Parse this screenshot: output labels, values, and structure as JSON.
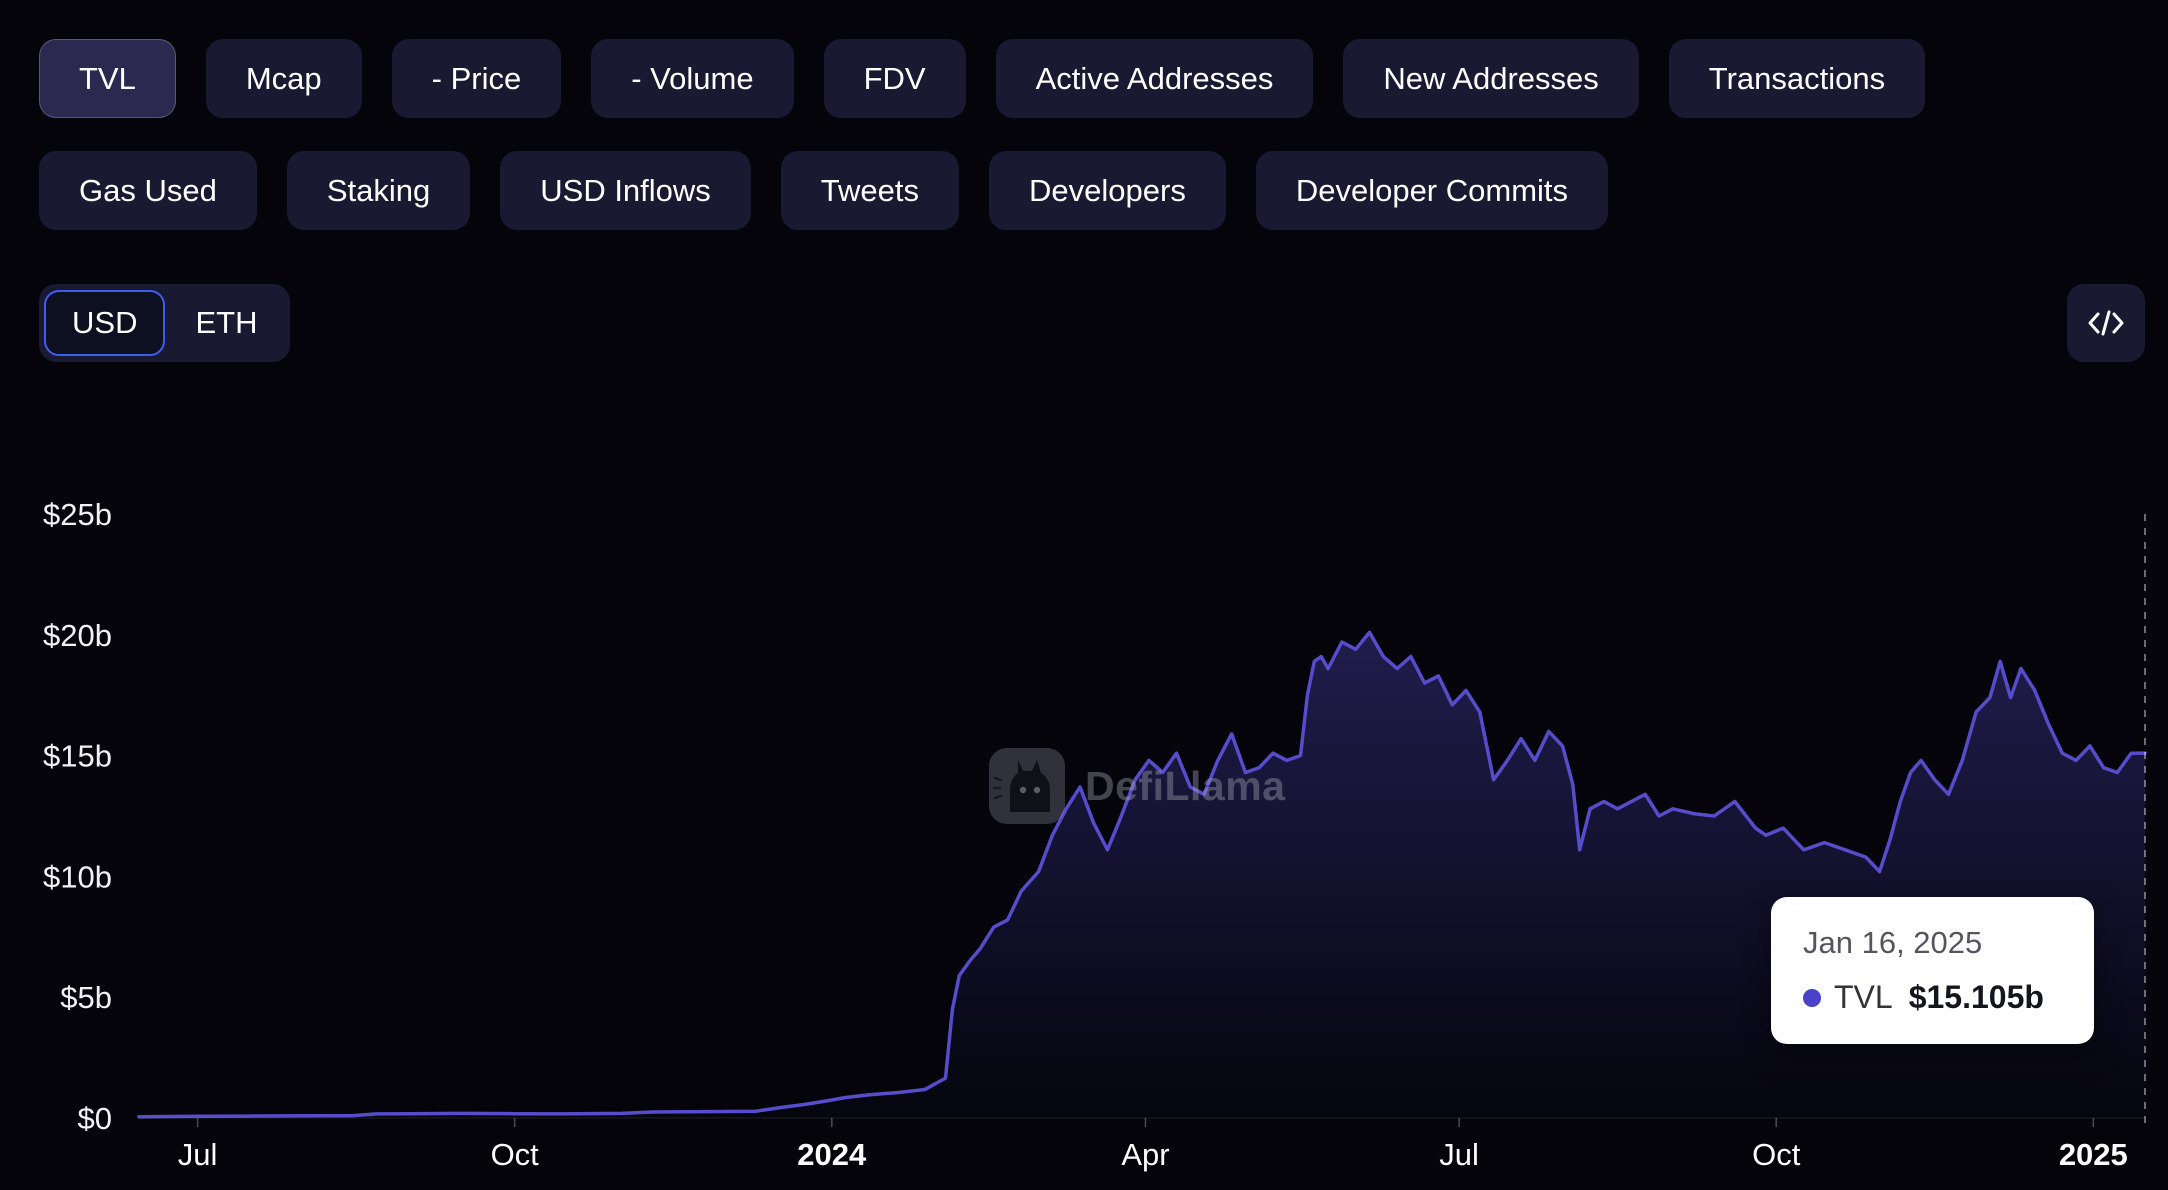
{
  "metric_tabs": {
    "row1": [
      {
        "label": "TVL",
        "active": true
      },
      {
        "label": "Mcap",
        "active": false
      },
      {
        "label": "- Price",
        "active": false
      },
      {
        "label": "- Volume",
        "active": false
      },
      {
        "label": "FDV",
        "active": false
      },
      {
        "label": "Active Addresses",
        "active": false
      },
      {
        "label": "New Addresses",
        "active": false
      },
      {
        "label": "Transactions",
        "active": false
      }
    ],
    "row2": [
      {
        "label": "Gas Used",
        "active": false
      },
      {
        "label": "Staking",
        "active": false
      },
      {
        "label": "USD Inflows",
        "active": false
      },
      {
        "label": "Tweets",
        "active": false
      },
      {
        "label": "Developers",
        "active": false
      },
      {
        "label": "Developer Commits",
        "active": false
      }
    ]
  },
  "currency_toggle": {
    "options": [
      "USD",
      "ETH"
    ],
    "selected": "USD"
  },
  "embed_button": {
    "icon": "code-embed-icon"
  },
  "watermark": {
    "icon": "defillama-logo-icon",
    "text": "DefiLlama"
  },
  "tooltip": {
    "date": "Jan 16, 2025",
    "series": "TVL",
    "value": "$15.105b",
    "marker_color": "#4c41c9"
  },
  "colors": {
    "background": "#04040a",
    "button_bg": "#1a1932",
    "button_active_bg": "#2b2950",
    "toggle_selected_border": "#3e5df0",
    "line": "#564ccc",
    "tooltip_bg": "#ffffff",
    "crosshair": "rgba(255,255,255,0.55)"
  },
  "chart_data": {
    "type": "area",
    "title": "",
    "xlabel": "",
    "ylabel": "",
    "unit": "USD billions",
    "grid": false,
    "legend": false,
    "ylim": [
      0,
      25
    ],
    "x_range": [
      "2023-06-14",
      "2025-01-16"
    ],
    "y_ticks": [
      {
        "label": "$0",
        "value": 0
      },
      {
        "label": "$5b",
        "value": 5
      },
      {
        "label": "$10b",
        "value": 10
      },
      {
        "label": "$15b",
        "value": 15
      },
      {
        "label": "$20b",
        "value": 20
      },
      {
        "label": "$25b",
        "value": 25
      }
    ],
    "x_ticks": [
      {
        "label": "Jul",
        "date": "2023-07-01",
        "bold": false
      },
      {
        "label": "Oct",
        "date": "2023-10-01",
        "bold": false
      },
      {
        "label": "2024",
        "date": "2024-01-01",
        "bold": true
      },
      {
        "label": "Apr",
        "date": "2024-04-01",
        "bold": false
      },
      {
        "label": "Jul",
        "date": "2024-07-01",
        "bold": false
      },
      {
        "label": "Oct",
        "date": "2024-10-01",
        "bold": false
      },
      {
        "label": "2025",
        "date": "2025-01-01",
        "bold": true
      }
    ],
    "crosshair_date": "2025-01-16",
    "highlight": {
      "date": "2025-01-16",
      "value": 15.105
    },
    "series": [
      {
        "name": "TVL",
        "color": "#564ccc",
        "points": [
          [
            "2023-06-14",
            0.05
          ],
          [
            "2023-07-01",
            0.07
          ],
          [
            "2023-07-15",
            0.08
          ],
          [
            "2023-08-01",
            0.09
          ],
          [
            "2023-08-15",
            0.1
          ],
          [
            "2023-08-22",
            0.17
          ],
          [
            "2023-09-01",
            0.18
          ],
          [
            "2023-09-15",
            0.19
          ],
          [
            "2023-10-01",
            0.18
          ],
          [
            "2023-10-15",
            0.17
          ],
          [
            "2023-11-01",
            0.19
          ],
          [
            "2023-11-10",
            0.25
          ],
          [
            "2023-11-20",
            0.26
          ],
          [
            "2023-12-01",
            0.27
          ],
          [
            "2023-12-10",
            0.28
          ],
          [
            "2023-12-18",
            0.45
          ],
          [
            "2023-12-24",
            0.56
          ],
          [
            "2023-12-31",
            0.72
          ],
          [
            "2024-01-05",
            0.85
          ],
          [
            "2024-01-12",
            0.96
          ],
          [
            "2024-01-20",
            1.05
          ],
          [
            "2024-01-28",
            1.18
          ],
          [
            "2024-02-03",
            1.65
          ],
          [
            "2024-02-05",
            4.5
          ],
          [
            "2024-02-07",
            5.9
          ],
          [
            "2024-02-10",
            6.5
          ],
          [
            "2024-02-13",
            7.0
          ],
          [
            "2024-02-17",
            7.9
          ],
          [
            "2024-02-21",
            8.2
          ],
          [
            "2024-02-25",
            9.4
          ],
          [
            "2024-03-01",
            10.2
          ],
          [
            "2024-03-05",
            11.7
          ],
          [
            "2024-03-09",
            12.8
          ],
          [
            "2024-03-13",
            13.7
          ],
          [
            "2024-03-17",
            12.2
          ],
          [
            "2024-03-21",
            11.1
          ],
          [
            "2024-03-25",
            12.5
          ],
          [
            "2024-03-29",
            14.0
          ],
          [
            "2024-04-02",
            14.8
          ],
          [
            "2024-04-06",
            14.3
          ],
          [
            "2024-04-10",
            15.1
          ],
          [
            "2024-04-14",
            13.7
          ],
          [
            "2024-04-18",
            13.4
          ],
          [
            "2024-04-22",
            14.8
          ],
          [
            "2024-04-26",
            15.9
          ],
          [
            "2024-04-30",
            14.3
          ],
          [
            "2024-05-04",
            14.5
          ],
          [
            "2024-05-08",
            15.1
          ],
          [
            "2024-05-12",
            14.8
          ],
          [
            "2024-05-16",
            15.0
          ],
          [
            "2024-05-18",
            17.5
          ],
          [
            "2024-05-20",
            18.9
          ],
          [
            "2024-05-22",
            19.1
          ],
          [
            "2024-05-24",
            18.6
          ],
          [
            "2024-05-28",
            19.7
          ],
          [
            "2024-06-01",
            19.4
          ],
          [
            "2024-06-05",
            20.1
          ],
          [
            "2024-06-09",
            19.1
          ],
          [
            "2024-06-13",
            18.6
          ],
          [
            "2024-06-17",
            19.1
          ],
          [
            "2024-06-21",
            18.0
          ],
          [
            "2024-06-25",
            18.3
          ],
          [
            "2024-06-29",
            17.1
          ],
          [
            "2024-07-03",
            17.7
          ],
          [
            "2024-07-07",
            16.8
          ],
          [
            "2024-07-11",
            14.0
          ],
          [
            "2024-07-15",
            14.8
          ],
          [
            "2024-07-19",
            15.7
          ],
          [
            "2024-07-23",
            14.8
          ],
          [
            "2024-07-27",
            16.0
          ],
          [
            "2024-07-31",
            15.4
          ],
          [
            "2024-08-03",
            13.8
          ],
          [
            "2024-08-05",
            11.1
          ],
          [
            "2024-08-08",
            12.8
          ],
          [
            "2024-08-12",
            13.1
          ],
          [
            "2024-08-16",
            12.8
          ],
          [
            "2024-08-20",
            13.1
          ],
          [
            "2024-08-24",
            13.4
          ],
          [
            "2024-08-28",
            12.5
          ],
          [
            "2024-09-01",
            12.8
          ],
          [
            "2024-09-07",
            12.6
          ],
          [
            "2024-09-13",
            12.5
          ],
          [
            "2024-09-19",
            13.1
          ],
          [
            "2024-09-25",
            12.0
          ],
          [
            "2024-09-28",
            11.7
          ],
          [
            "2024-10-03",
            12.0
          ],
          [
            "2024-10-09",
            11.1
          ],
          [
            "2024-10-15",
            11.4
          ],
          [
            "2024-10-21",
            11.1
          ],
          [
            "2024-10-27",
            10.8
          ],
          [
            "2024-10-31",
            10.2
          ],
          [
            "2024-11-03",
            11.5
          ],
          [
            "2024-11-06",
            13.1
          ],
          [
            "2024-11-09",
            14.3
          ],
          [
            "2024-11-12",
            14.8
          ],
          [
            "2024-11-16",
            14.0
          ],
          [
            "2024-11-20",
            13.4
          ],
          [
            "2024-11-24",
            14.8
          ],
          [
            "2024-11-28",
            16.8
          ],
          [
            "2024-12-02",
            17.4
          ],
          [
            "2024-12-05",
            18.9
          ],
          [
            "2024-12-08",
            17.4
          ],
          [
            "2024-12-11",
            18.6
          ],
          [
            "2024-12-15",
            17.7
          ],
          [
            "2024-12-19",
            16.3
          ],
          [
            "2024-12-23",
            15.1
          ],
          [
            "2024-12-27",
            14.8
          ],
          [
            "2024-12-31",
            15.4
          ],
          [
            "2025-01-04",
            14.5
          ],
          [
            "2025-01-08",
            14.3
          ],
          [
            "2025-01-12",
            15.1
          ],
          [
            "2025-01-16",
            15.105
          ]
        ]
      }
    ]
  }
}
